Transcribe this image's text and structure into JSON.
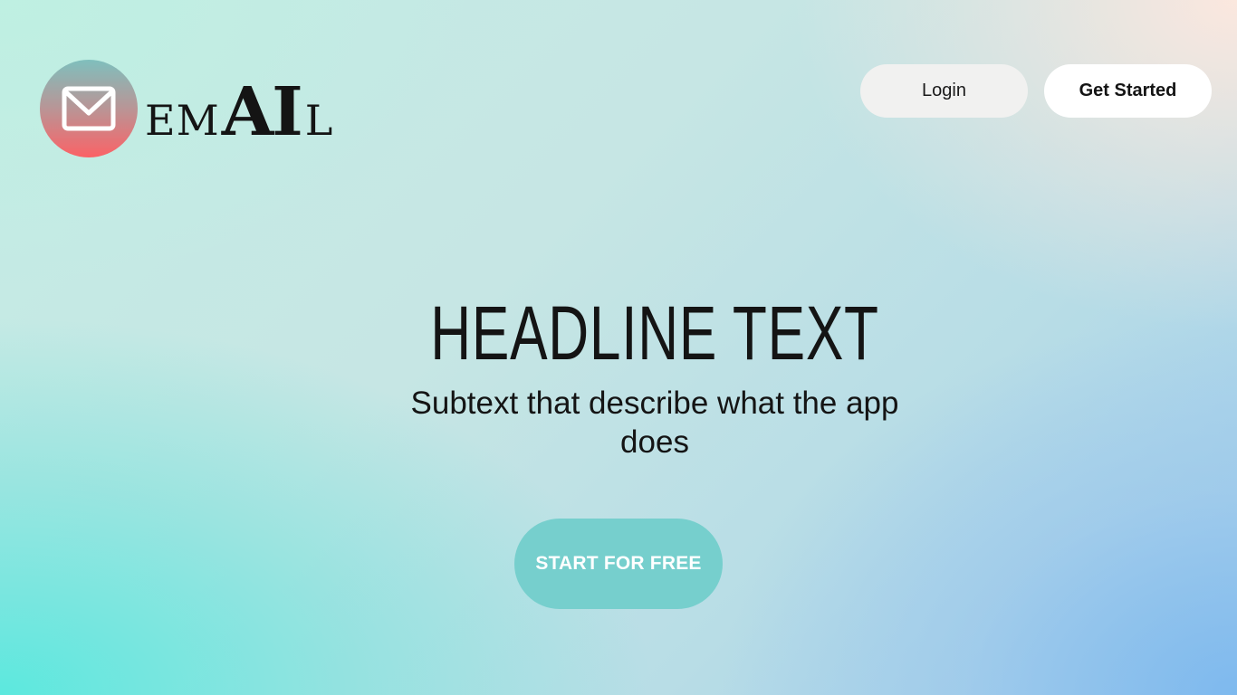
{
  "header": {
    "logo": {
      "icon": "envelope-icon",
      "wordmark_parts": [
        "EM",
        "AI",
        "L"
      ]
    },
    "login_label": "Login",
    "get_started_label": "Get Started"
  },
  "hero": {
    "headline": "HEADLINE TEXT",
    "subtext": "Subtext that describe what the app does",
    "cta_label": "START FOR FREE"
  },
  "colors": {
    "cta_background": "#76cfcd",
    "logo_gradient_top": "#7fbfbd",
    "logo_gradient_bottom": "#fb6266",
    "text": "#141414"
  }
}
